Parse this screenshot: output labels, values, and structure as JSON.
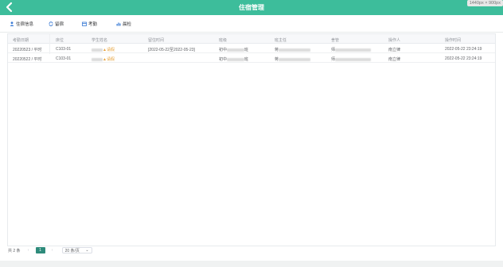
{
  "header": {
    "title": "住宿管理",
    "resolution_badge": "1440px × 900px"
  },
  "tabs": [
    {
      "label": "住宿信息",
      "icon": "person-icon"
    },
    {
      "label": "留宿",
      "icon": "refresh-icon"
    },
    {
      "label": "考勤",
      "icon": "calendar-icon"
    },
    {
      "label": "晨检",
      "icon": "chart-icon"
    }
  ],
  "table": {
    "columns": [
      "考勤日期",
      "床位",
      "学生姓名",
      "留住时间",
      "班级",
      "班主任",
      "舍管",
      "操作人",
      "操作时间"
    ],
    "rows": [
      {
        "date": "20220523 / 平时",
        "bed": "C103-01",
        "student_tag": "请假",
        "stay_time": "[2022-05-22至2022-05-23]",
        "class_prefix": "初中",
        "class_suffix": "班",
        "teacher_prefix": "蒋",
        "warden_prefix": "师",
        "operator": "南立律",
        "op_time": "2022-05-22 23:24:19"
      },
      {
        "date": "20220522 / 平时",
        "bed": "C103-01",
        "student_tag": "请假",
        "stay_time": "",
        "class_prefix": "初中",
        "class_suffix": "班",
        "teacher_prefix": "蒋",
        "warden_prefix": "师",
        "operator": "南立律",
        "op_time": "2022-05-22 23:24:19"
      }
    ]
  },
  "pagination": {
    "total_text": "共 2 条",
    "prev": "‹",
    "current_page": "1",
    "next": "›",
    "page_size": "20 条/页",
    "dropdown_glyph": "⌄"
  },
  "colors": {
    "brand": "#3dbd9b",
    "active_page": "#2e8b7b",
    "warning": "#e6a23c"
  }
}
